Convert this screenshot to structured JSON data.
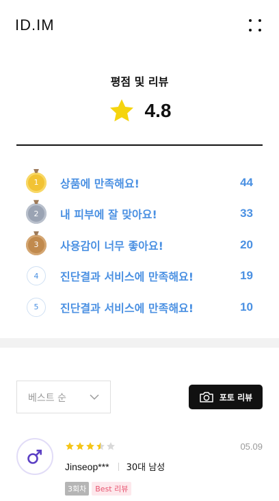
{
  "header": {
    "logo": "ID.IM",
    "menu_icon": "dots-grid-icon"
  },
  "rating": {
    "title": "평점 및 리뷰",
    "star_icon": "star-icon",
    "star_color": "#f5d40f",
    "score": "4.8"
  },
  "ranking": [
    {
      "rank": "1",
      "label": "상품에 만족해요!",
      "count": "44",
      "medal": "gold-medal-icon"
    },
    {
      "rank": "2",
      "label": "내 피부에 잘 맞아요!",
      "count": "33",
      "medal": "silver-medal-icon"
    },
    {
      "rank": "3",
      "label": "사용감이 너무 좋아요!",
      "count": "20",
      "medal": "bronze-medal-icon"
    },
    {
      "rank": "4",
      "label": "진단결과 서비스에 만족해요!",
      "count": "19",
      "medal": "rank-circle-icon"
    },
    {
      "rank": "5",
      "label": "진단결과 서비스에 만족해요!",
      "count": "10",
      "medal": "rank-circle-icon"
    }
  ],
  "accent_color": "#4a90e2",
  "sort": {
    "selected": "베스트 순",
    "icon": "chevron-down-icon"
  },
  "photo_review": {
    "label": "포토 리뷰",
    "icon": "camera-icon"
  },
  "review": {
    "avatar_icon": "male-symbol-icon",
    "stars": 3.5,
    "date": "05.09",
    "name": "Jinseop***",
    "info": "30대 남성",
    "badge_count": "3회차",
    "badge_best": "Best 리뷰"
  }
}
